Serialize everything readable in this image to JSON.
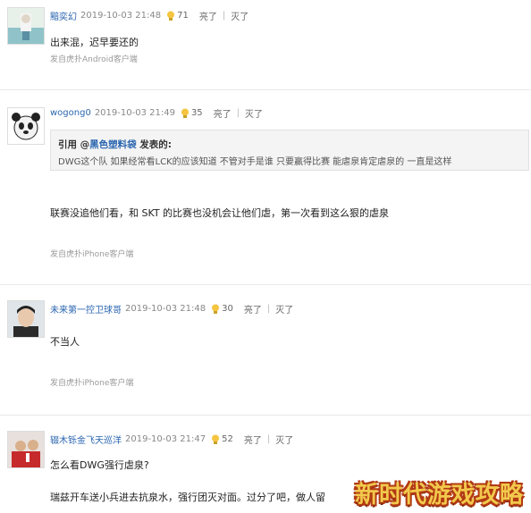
{
  "posts": [
    {
      "user": "黯奕幻",
      "time": "2019-10-03 21:48",
      "likes": "71",
      "like_label": "亮了",
      "hide_label": "灭了",
      "text": "出来混，迟早要还的",
      "source": "发自虎扑Android客户端"
    },
    {
      "user": "wogong0",
      "time": "2019-10-03 21:49",
      "likes": "35",
      "like_label": "亮了",
      "hide_label": "灭了",
      "quote_prefix": "引用 @",
      "quote_user": "黑色塑料袋",
      "quote_suffix": " 发表的:",
      "quote_text": "DWG这个队 如果经常看LCK的应该知道 不管对手是谁 只要赢得比赛 能虐泉肯定虐泉的 一直是这样",
      "text": "联赛没追他们看，和 SKT 的比赛也没机会让他们虐，第一次看到这么狠的虐泉",
      "source": "发自虎扑iPhone客户端"
    },
    {
      "user": "未来第一控卫球哥",
      "time": "2019-10-03 21:48",
      "likes": "30",
      "like_label": "亮了",
      "hide_label": "灭了",
      "text": "不当人",
      "source": "发自虎扑iPhone客户端"
    },
    {
      "user": "辍木铄金飞天巡洋",
      "time": "2019-10-03 21:47",
      "likes": "52",
      "like_label": "亮了",
      "hide_label": "灭了",
      "text": "怎么看DWG强行虐泉?",
      "text2": "瑞兹开车送小兵进去抗泉水，强行团灭对面。过分了吧，做人留"
    }
  ],
  "watermark": "新时代游戏攻略",
  "colors": {
    "username": "#2b66b0",
    "meta": "#888888",
    "quote_bg": "#f4f4f4"
  }
}
